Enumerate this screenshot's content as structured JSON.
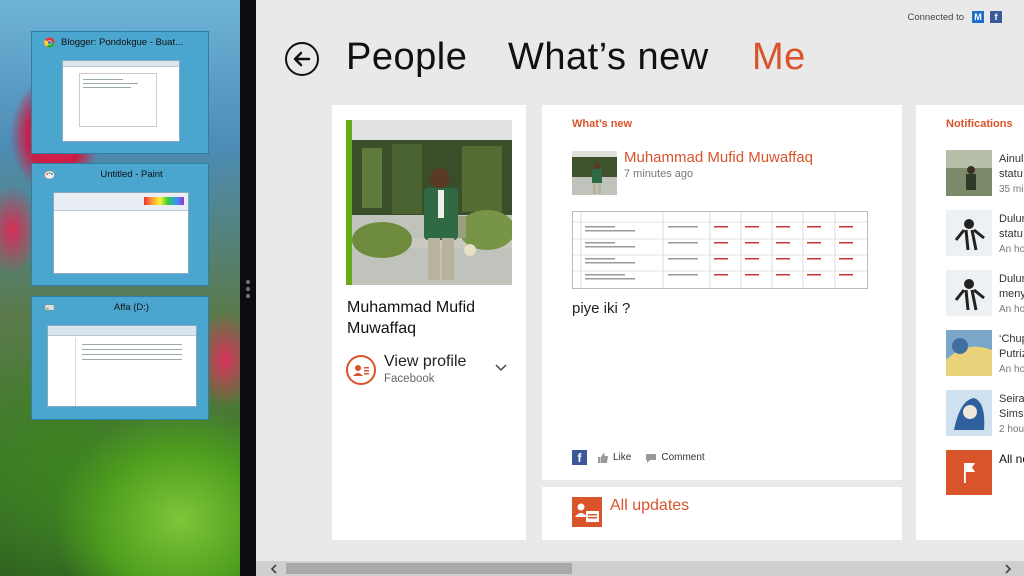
{
  "switcher": {
    "items": [
      {
        "title": "Blogger: Pondokgue - Buat..."
      },
      {
        "title": "Untitled - Paint"
      },
      {
        "title": "Affa (D:)"
      }
    ]
  },
  "header": {
    "connected_label": "Connected to",
    "services": [
      "M",
      "f"
    ],
    "pivots": [
      "People",
      "What’s new",
      "Me"
    ],
    "active_pivot": "Me"
  },
  "profile": {
    "name": "Muhammad Mufid Muwaffaq",
    "view_profile_label": "View profile",
    "view_profile_source": "Facebook"
  },
  "whats_new": {
    "section_title": "What’s new",
    "author": "Muhammad Mufid Muwaffaq",
    "time": "7 minutes ago",
    "status_text": "piye iki ?",
    "like_label": "Like",
    "comment_label": "Comment"
  },
  "all_updates": {
    "label": "All updates"
  },
  "notifications": {
    "section_title": "Notifications",
    "items": [
      {
        "line1": "Ainul",
        "line2": "statu",
        "time": "35 mi"
      },
      {
        "line1": "Dulur",
        "line2": "statu",
        "time": "An ho"
      },
      {
        "line1": "Dulur",
        "line2": "meny",
        "time": "An ho"
      },
      {
        "line1": "‘Chup",
        "line2": "Putriz",
        "time": "An ho"
      },
      {
        "line1": "Seira",
        "line2": "Sims",
        "time": "2 hou"
      }
    ],
    "all_label": "All no"
  },
  "colors": {
    "accent": "#d9532b",
    "switcher_tile": "#4aa6cf",
    "green_accent": "#6aab1e"
  }
}
